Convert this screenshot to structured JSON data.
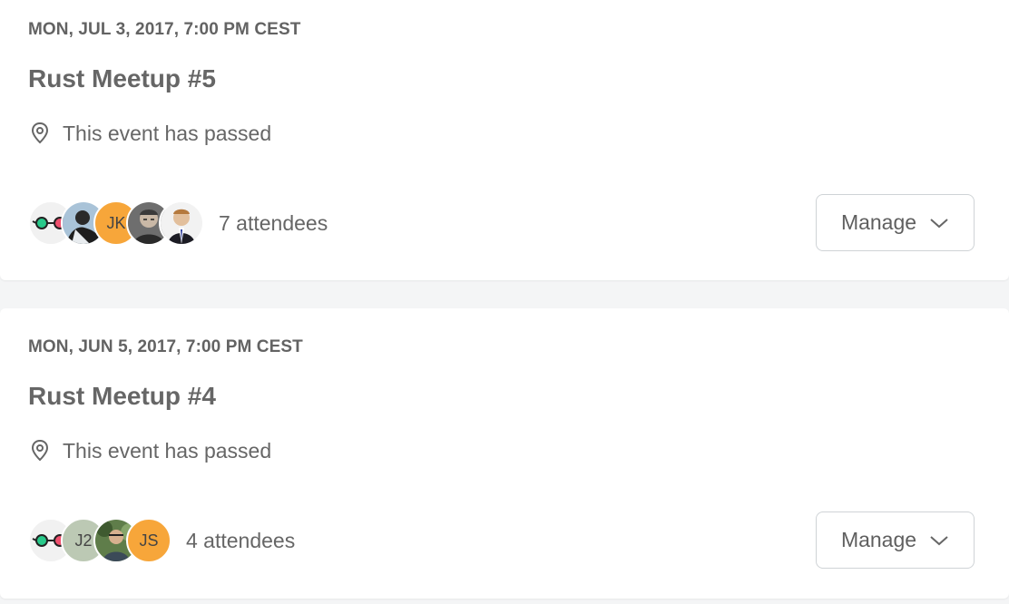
{
  "events": [
    {
      "date": "MON, JUL 3, 2017, 7:00 PM CEST",
      "title": "Rust Meetup #5",
      "location": "This event has passed",
      "attendees": {
        "count_label": "7 attendees",
        "avatars": [
          {
            "type": "glasses-icon"
          },
          {
            "type": "photo",
            "name": "photo-avatar"
          },
          {
            "type": "initials",
            "initials": "JK",
            "color": "#f7a63a"
          },
          {
            "type": "photo",
            "name": "photo-avatar"
          },
          {
            "type": "photo",
            "name": "photo-avatar"
          }
        ]
      },
      "manage_label": "Manage"
    },
    {
      "date": "MON, JUN 5, 2017, 7:00 PM CEST",
      "title": "Rust Meetup #4",
      "location": "This event has passed",
      "attendees": {
        "count_label": "4 attendees",
        "avatars": [
          {
            "type": "glasses-icon"
          },
          {
            "type": "initials",
            "initials": "J2",
            "color": "#bcc9b4"
          },
          {
            "type": "photo",
            "name": "photo-avatar"
          },
          {
            "type": "initials",
            "initials": "JS",
            "color": "#f7a63a"
          }
        ]
      },
      "manage_label": "Manage"
    }
  ],
  "colors": {
    "background": "#f4f5f6",
    "card": "#ffffff",
    "text": "#666666",
    "glasses_left": "#28c98a",
    "glasses_right": "#f0506e"
  }
}
